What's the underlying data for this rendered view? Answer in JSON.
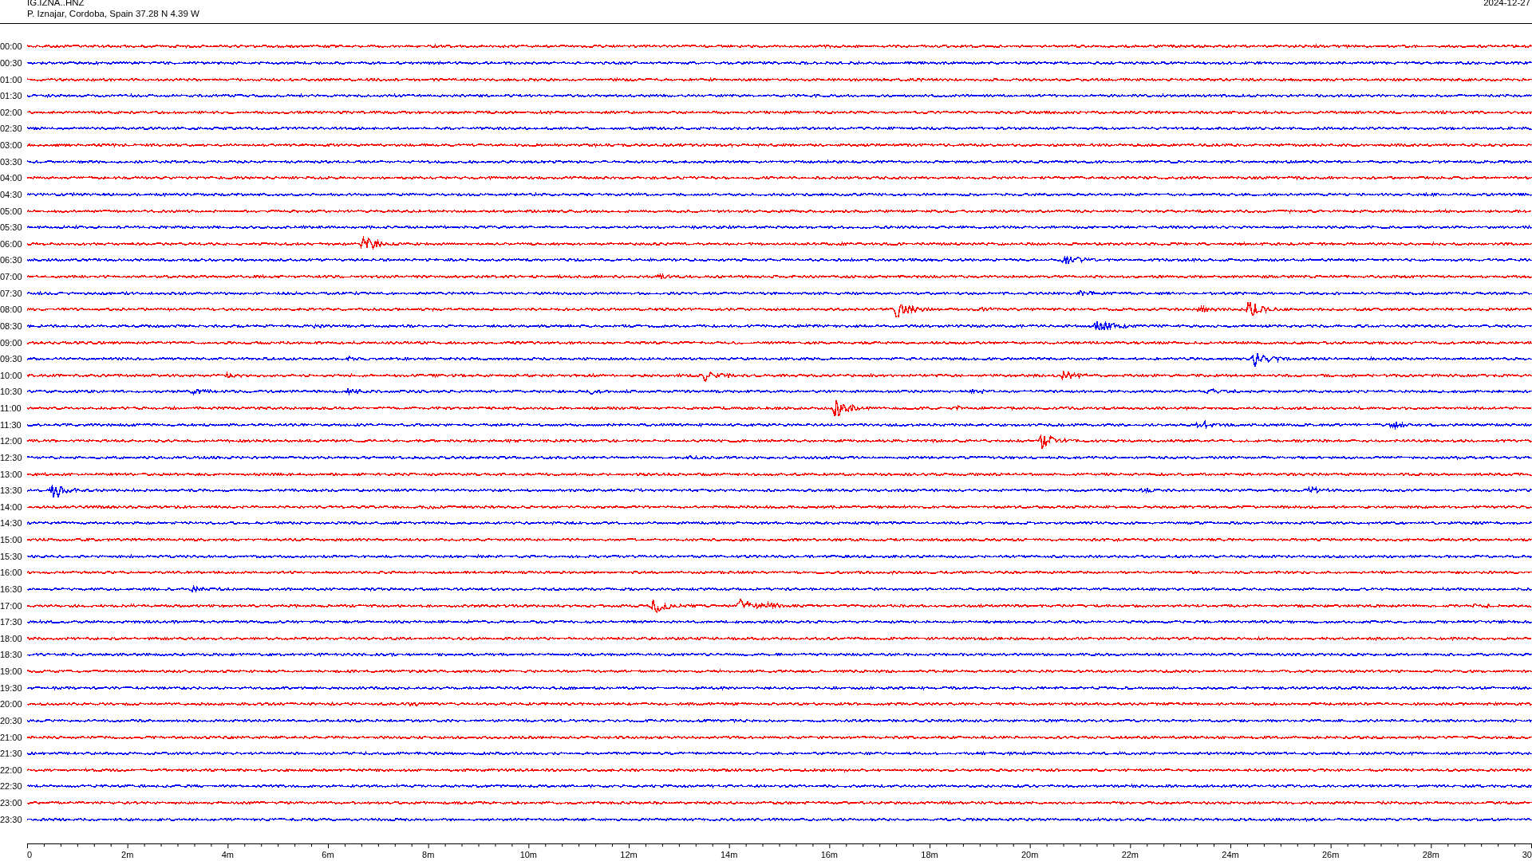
{
  "header": {
    "station": "IG.IZNA..HNZ",
    "location": "P. Iznajar, Cordoba, Spain  37.28 N 4.39 W",
    "date": "2024-12-27"
  },
  "rows": [
    {
      "time": "00:00",
      "color": "#ff0000"
    },
    {
      "time": "00:30",
      "color": "#0000ff"
    },
    {
      "time": "01:00",
      "color": "#ff0000"
    },
    {
      "time": "01:30",
      "color": "#0000ff"
    },
    {
      "time": "02:00",
      "color": "#ff0000"
    },
    {
      "time": "02:30",
      "color": "#0000ff"
    },
    {
      "time": "03:00",
      "color": "#ff0000"
    },
    {
      "time": "03:30",
      "color": "#0000ff"
    },
    {
      "time": "04:00",
      "color": "#ff0000"
    },
    {
      "time": "04:30",
      "color": "#0000ff"
    },
    {
      "time": "05:00",
      "color": "#ff0000"
    },
    {
      "time": "05:30",
      "color": "#0000ff"
    },
    {
      "time": "06:00",
      "color": "#ff0000"
    },
    {
      "time": "06:30",
      "color": "#0000ff"
    },
    {
      "time": "07:00",
      "color": "#ff0000"
    },
    {
      "time": "07:30",
      "color": "#0000ff"
    },
    {
      "time": "08:00",
      "color": "#ff0000"
    },
    {
      "time": "08:30",
      "color": "#0000ff"
    },
    {
      "time": "09:00",
      "color": "#ff0000"
    },
    {
      "time": "09:30",
      "color": "#0000ff"
    },
    {
      "time": "10:00",
      "color": "#ff0000"
    },
    {
      "time": "10:30",
      "color": "#0000ff"
    },
    {
      "time": "11:00",
      "color": "#ff0000"
    },
    {
      "time": "11:30",
      "color": "#0000ff"
    },
    {
      "time": "12:00",
      "color": "#ff0000"
    },
    {
      "time": "12:30",
      "color": "#0000ff"
    },
    {
      "time": "13:00",
      "color": "#ff0000"
    },
    {
      "time": "13:30",
      "color": "#0000ff"
    },
    {
      "time": "14:00",
      "color": "#ff0000"
    },
    {
      "time": "14:30",
      "color": "#0000ff"
    },
    {
      "time": "15:00",
      "color": "#ff0000"
    },
    {
      "time": "15:30",
      "color": "#0000ff"
    },
    {
      "time": "16:00",
      "color": "#ff0000"
    },
    {
      "time": "16:30",
      "color": "#0000ff"
    },
    {
      "time": "17:00",
      "color": "#ff0000"
    },
    {
      "time": "17:30",
      "color": "#0000ff"
    },
    {
      "time": "18:00",
      "color": "#ff0000"
    },
    {
      "time": "18:30",
      "color": "#0000ff"
    },
    {
      "time": "19:00",
      "color": "#ff0000"
    },
    {
      "time": "19:30",
      "color": "#0000ff"
    },
    {
      "time": "20:00",
      "color": "#ff0000"
    },
    {
      "time": "20:30",
      "color": "#0000ff"
    },
    {
      "time": "21:00",
      "color": "#ff0000"
    },
    {
      "time": "21:30",
      "color": "#0000ff"
    },
    {
      "time": "22:00",
      "color": "#ff0000"
    },
    {
      "time": "22:30",
      "color": "#0000ff"
    },
    {
      "time": "23:00",
      "color": "#ff0000"
    },
    {
      "time": "23:30",
      "color": "#0000ff"
    }
  ],
  "axis": {
    "labels": [
      "0",
      "2m",
      "4m",
      "6m",
      "8m",
      "10m",
      "12m",
      "14m",
      "16m",
      "18m",
      "20m",
      "22m",
      "24m",
      "26m",
      "28m",
      "30"
    ]
  }
}
